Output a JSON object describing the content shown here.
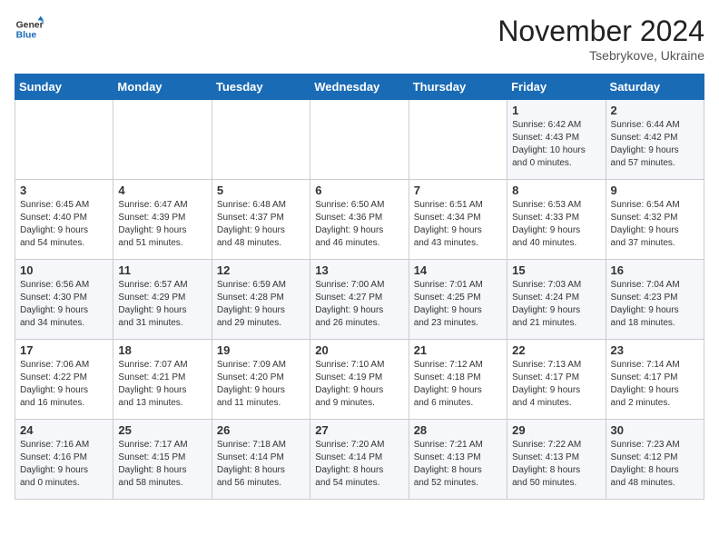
{
  "logo": {
    "line1": "General",
    "line2": "Blue"
  },
  "title": "November 2024",
  "subtitle": "Tsebrykove, Ukraine",
  "weekdays": [
    "Sunday",
    "Monday",
    "Tuesday",
    "Wednesday",
    "Thursday",
    "Friday",
    "Saturday"
  ],
  "weeks": [
    [
      {
        "day": "",
        "info": ""
      },
      {
        "day": "",
        "info": ""
      },
      {
        "day": "",
        "info": ""
      },
      {
        "day": "",
        "info": ""
      },
      {
        "day": "",
        "info": ""
      },
      {
        "day": "1",
        "info": "Sunrise: 6:42 AM\nSunset: 4:43 PM\nDaylight: 10 hours\nand 0 minutes."
      },
      {
        "day": "2",
        "info": "Sunrise: 6:44 AM\nSunset: 4:42 PM\nDaylight: 9 hours\nand 57 minutes."
      }
    ],
    [
      {
        "day": "3",
        "info": "Sunrise: 6:45 AM\nSunset: 4:40 PM\nDaylight: 9 hours\nand 54 minutes."
      },
      {
        "day": "4",
        "info": "Sunrise: 6:47 AM\nSunset: 4:39 PM\nDaylight: 9 hours\nand 51 minutes."
      },
      {
        "day": "5",
        "info": "Sunrise: 6:48 AM\nSunset: 4:37 PM\nDaylight: 9 hours\nand 48 minutes."
      },
      {
        "day": "6",
        "info": "Sunrise: 6:50 AM\nSunset: 4:36 PM\nDaylight: 9 hours\nand 46 minutes."
      },
      {
        "day": "7",
        "info": "Sunrise: 6:51 AM\nSunset: 4:34 PM\nDaylight: 9 hours\nand 43 minutes."
      },
      {
        "day": "8",
        "info": "Sunrise: 6:53 AM\nSunset: 4:33 PM\nDaylight: 9 hours\nand 40 minutes."
      },
      {
        "day": "9",
        "info": "Sunrise: 6:54 AM\nSunset: 4:32 PM\nDaylight: 9 hours\nand 37 minutes."
      }
    ],
    [
      {
        "day": "10",
        "info": "Sunrise: 6:56 AM\nSunset: 4:30 PM\nDaylight: 9 hours\nand 34 minutes."
      },
      {
        "day": "11",
        "info": "Sunrise: 6:57 AM\nSunset: 4:29 PM\nDaylight: 9 hours\nand 31 minutes."
      },
      {
        "day": "12",
        "info": "Sunrise: 6:59 AM\nSunset: 4:28 PM\nDaylight: 9 hours\nand 29 minutes."
      },
      {
        "day": "13",
        "info": "Sunrise: 7:00 AM\nSunset: 4:27 PM\nDaylight: 9 hours\nand 26 minutes."
      },
      {
        "day": "14",
        "info": "Sunrise: 7:01 AM\nSunset: 4:25 PM\nDaylight: 9 hours\nand 23 minutes."
      },
      {
        "day": "15",
        "info": "Sunrise: 7:03 AM\nSunset: 4:24 PM\nDaylight: 9 hours\nand 21 minutes."
      },
      {
        "day": "16",
        "info": "Sunrise: 7:04 AM\nSunset: 4:23 PM\nDaylight: 9 hours\nand 18 minutes."
      }
    ],
    [
      {
        "day": "17",
        "info": "Sunrise: 7:06 AM\nSunset: 4:22 PM\nDaylight: 9 hours\nand 16 minutes."
      },
      {
        "day": "18",
        "info": "Sunrise: 7:07 AM\nSunset: 4:21 PM\nDaylight: 9 hours\nand 13 minutes."
      },
      {
        "day": "19",
        "info": "Sunrise: 7:09 AM\nSunset: 4:20 PM\nDaylight: 9 hours\nand 11 minutes."
      },
      {
        "day": "20",
        "info": "Sunrise: 7:10 AM\nSunset: 4:19 PM\nDaylight: 9 hours\nand 9 minutes."
      },
      {
        "day": "21",
        "info": "Sunrise: 7:12 AM\nSunset: 4:18 PM\nDaylight: 9 hours\nand 6 minutes."
      },
      {
        "day": "22",
        "info": "Sunrise: 7:13 AM\nSunset: 4:17 PM\nDaylight: 9 hours\nand 4 minutes."
      },
      {
        "day": "23",
        "info": "Sunrise: 7:14 AM\nSunset: 4:17 PM\nDaylight: 9 hours\nand 2 minutes."
      }
    ],
    [
      {
        "day": "24",
        "info": "Sunrise: 7:16 AM\nSunset: 4:16 PM\nDaylight: 9 hours\nand 0 minutes."
      },
      {
        "day": "25",
        "info": "Sunrise: 7:17 AM\nSunset: 4:15 PM\nDaylight: 8 hours\nand 58 minutes."
      },
      {
        "day": "26",
        "info": "Sunrise: 7:18 AM\nSunset: 4:14 PM\nDaylight: 8 hours\nand 56 minutes."
      },
      {
        "day": "27",
        "info": "Sunrise: 7:20 AM\nSunset: 4:14 PM\nDaylight: 8 hours\nand 54 minutes."
      },
      {
        "day": "28",
        "info": "Sunrise: 7:21 AM\nSunset: 4:13 PM\nDaylight: 8 hours\nand 52 minutes."
      },
      {
        "day": "29",
        "info": "Sunrise: 7:22 AM\nSunset: 4:13 PM\nDaylight: 8 hours\nand 50 minutes."
      },
      {
        "day": "30",
        "info": "Sunrise: 7:23 AM\nSunset: 4:12 PM\nDaylight: 8 hours\nand 48 minutes."
      }
    ]
  ]
}
